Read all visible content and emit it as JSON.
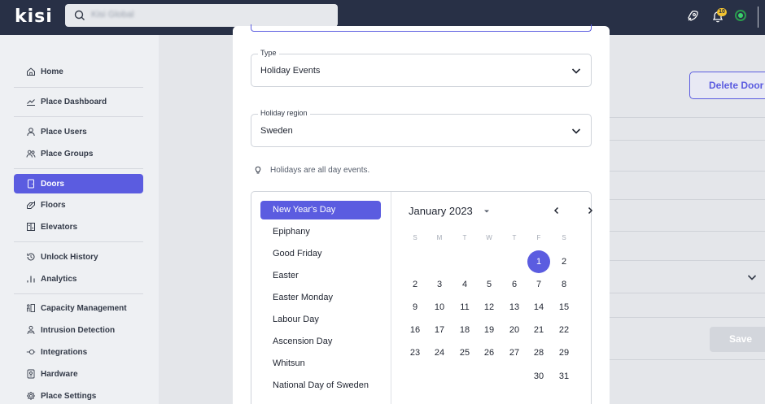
{
  "topbar": {
    "logo": "kisi",
    "search_text": "Kisi Global",
    "notification_count": "10"
  },
  "sidebar": {
    "items": [
      {
        "label": "Home",
        "icon": "home-icon"
      },
      {
        "label": "Place Dashboard",
        "icon": "chart-line-icon"
      },
      {
        "label": "Place Users",
        "icon": "user-icon"
      },
      {
        "label": "Place Groups",
        "icon": "users-icon"
      },
      {
        "label": "Doors",
        "icon": "door-icon"
      },
      {
        "label": "Floors",
        "icon": "floors-icon"
      },
      {
        "label": "Elevators",
        "icon": "elevator-icon"
      },
      {
        "label": "Unlock History",
        "icon": "history-icon"
      },
      {
        "label": "Analytics",
        "icon": "bar-chart-icon"
      },
      {
        "label": "Capacity Management",
        "icon": "capacity-icon"
      },
      {
        "label": "Intrusion Detection",
        "icon": "intrusion-icon"
      },
      {
        "label": "Integrations",
        "icon": "integrations-icon"
      },
      {
        "label": "Hardware",
        "icon": "hardware-icon"
      },
      {
        "label": "Place Settings",
        "icon": "gear-icon"
      }
    ],
    "active": "Doors"
  },
  "background": {
    "delete_button": "Delete Door",
    "save_button": "Save"
  },
  "modal": {
    "type_field": {
      "label": "Type",
      "value": "Holiday Events"
    },
    "region_field": {
      "label": "Holiday region",
      "value": "Sweden"
    },
    "hint": "Holidays are all day events.",
    "holidays": [
      "New Year's Day",
      "Epiphany",
      "Good Friday",
      "Easter",
      "Easter Monday",
      "Labour Day",
      "Ascension Day",
      "Whitsun",
      "National Day of Sweden"
    ],
    "selected_holiday": "New Year's Day",
    "calendar": {
      "month_label": "January 2023",
      "weekdays": [
        "S",
        "M",
        "T",
        "W",
        "T",
        "F",
        "S"
      ],
      "weeks": [
        [
          "",
          "",
          "",
          "",
          "",
          "1",
          "2"
        ],
        [
          "2",
          "3",
          "4",
          "5",
          "6",
          "7",
          "8"
        ],
        [
          "9",
          "10",
          "11",
          "12",
          "13",
          "14",
          "15"
        ],
        [
          "16",
          "17",
          "18",
          "19",
          "20",
          "21",
          "22"
        ],
        [
          "23",
          "24",
          "25",
          "26",
          "27",
          "28",
          "29"
        ],
        [
          "",
          "",
          "",
          "",
          "",
          "30",
          "31"
        ]
      ],
      "selected_day": "1"
    }
  },
  "colors": {
    "accent": "#5b5ce0",
    "topbar": "#283046",
    "status_online": "#3bd16c",
    "badge": "#f2c230"
  }
}
